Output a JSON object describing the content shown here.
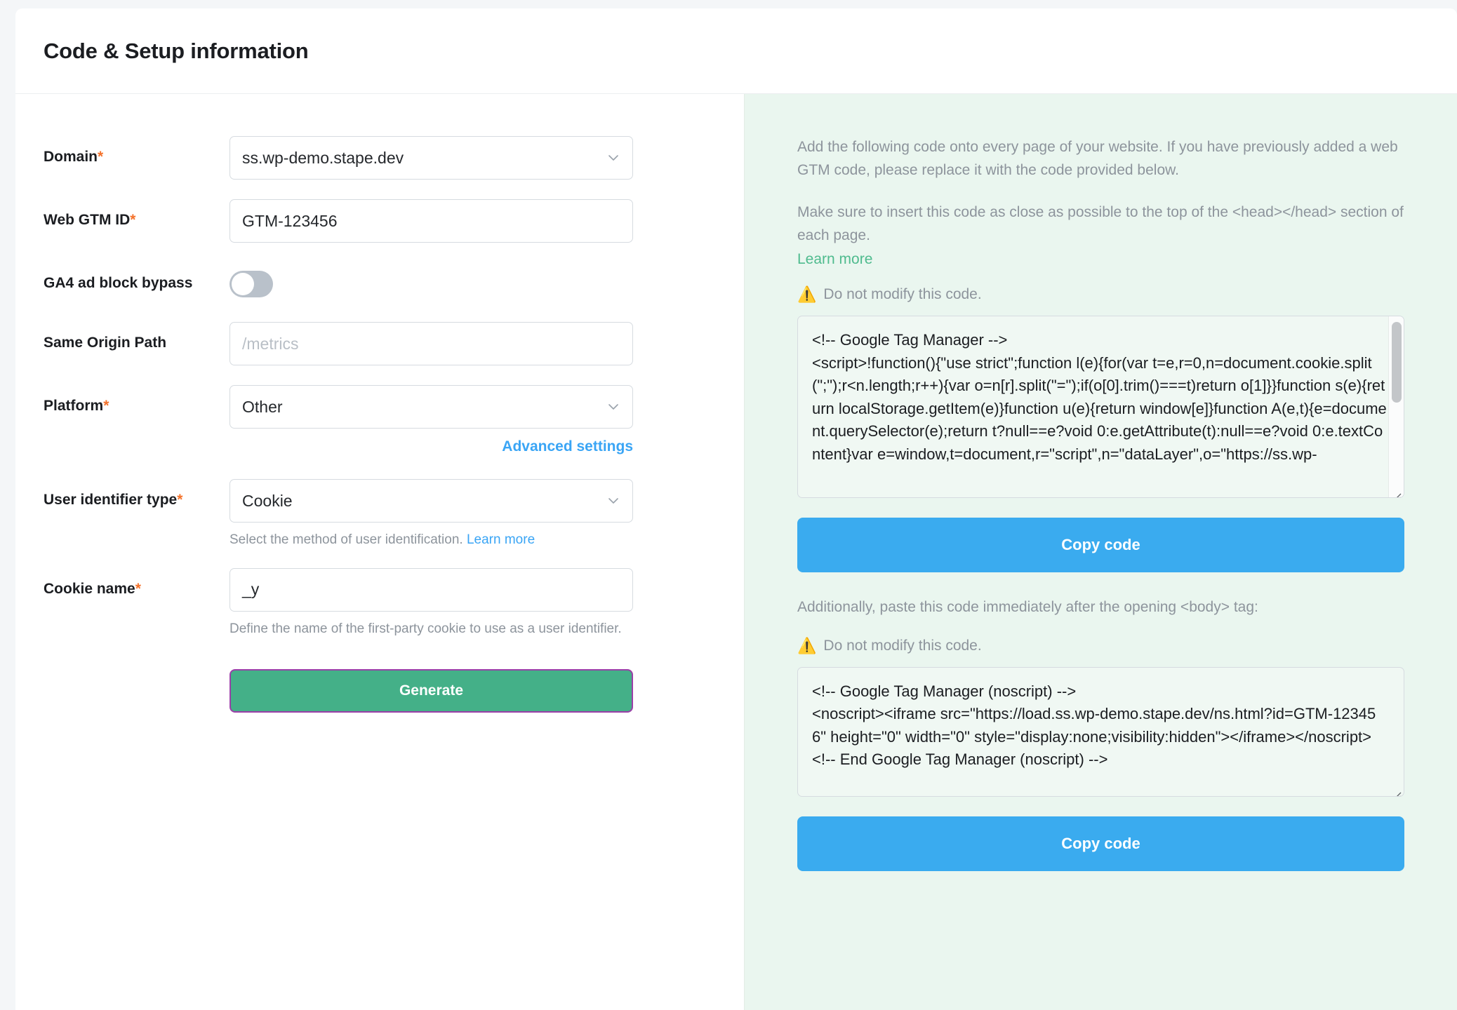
{
  "header": {
    "title": "Code & Setup information"
  },
  "form": {
    "domain": {
      "label": "Domain",
      "required": "*",
      "value": "ss.wp-demo.stape.dev"
    },
    "web_gtm_id": {
      "label": "Web GTM ID",
      "required": "*",
      "value": "GTM-123456"
    },
    "ga4_bypass": {
      "label": "GA4 ad block bypass",
      "state": "off"
    },
    "same_origin_path": {
      "label": "Same Origin Path",
      "value": "",
      "placeholder": "/metrics"
    },
    "platform": {
      "label": "Platform",
      "required": "*",
      "value": "Other"
    },
    "advanced_settings_link": "Advanced settings",
    "user_identifier_type": {
      "label": "User identifier type",
      "required": "*",
      "value": "Cookie",
      "helper": "Select the method of user identification.",
      "helper_link": "Learn more"
    },
    "cookie_name": {
      "label": "Cookie name",
      "required": "*",
      "value": "_y",
      "helper": "Define the name of the first-party cookie to use as a user identifier."
    },
    "generate_button": "Generate"
  },
  "right": {
    "intro_paragraph_1": "Add the following code onto every page of your website. If you have previously added a web GTM code, please replace it with the code provided below.",
    "intro_paragraph_2": "Make sure to insert this code as close as possible to the top of the <head></head> section of each page.",
    "learn_more": "Learn more",
    "warning_1": "Do not modify this code.",
    "warning_icon": "warning-triangle-icon",
    "head_code": "<!-- Google Tag Manager -->\n<script>!function(){\"use strict\";function l(e){for(var t=e,r=0,n=document.cookie.split(\";\");r<n.length;r++){var o=n[r].split(\"=\");if(o[0].trim()===t)return o[1]}}function s(e){return localStorage.getItem(e)}function u(e){return window[e]}function A(e,t){e=document.querySelector(e);return t?null==e?void 0:e.getAttribute(t):null==e?void 0:e.textContent}var e=window,t=document,r=\"script\",n=\"dataLayer\",o=\"https://ss.wp-",
    "copy_code_1": "Copy code",
    "body_note": "Additionally, paste this code immediately after the opening <body> tag:",
    "warning_2": "Do not modify this code.",
    "body_code": "<!-- Google Tag Manager (noscript) -->\n<noscript><iframe src=\"https://load.ss.wp-demo.stape.dev/ns.html?id=GTM-123456\" height=\"0\" width=\"0\" style=\"display:none;visibility:hidden\"></iframe></noscript>\n<!-- End Google Tag Manager (noscript) -->",
    "copy_code_2": "Copy code"
  },
  "colors": {
    "accent_blue": "#3aabef",
    "accent_green": "#44b088",
    "link_blue": "#3aa5f5",
    "link_green": "#4fbb8e",
    "required_orange": "#f4722b",
    "panel_mint": "#eaf6ef",
    "focus_purple": "#9b3fa8"
  }
}
